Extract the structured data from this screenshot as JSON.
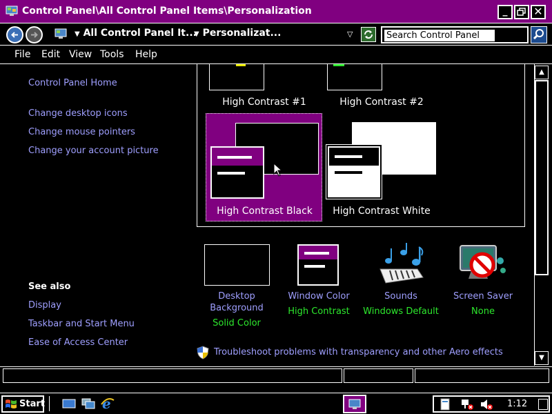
{
  "window": {
    "title": "Control Panel\\All Control Panel Items\\Personalization"
  },
  "address_bar": {
    "segment1": "All Control Panel It...",
    "segment2": "Personalizat...",
    "search_placeholder": "Search Control Panel"
  },
  "menu": {
    "items": [
      "File",
      "Edit",
      "View",
      "Tools",
      "Help"
    ]
  },
  "left_pane": {
    "home_link": "Control Panel Home",
    "links": [
      "Change desktop icons",
      "Change mouse pointers",
      "Change your account picture"
    ],
    "see_also_heading": "See also",
    "see_also_links": [
      "Display",
      "Taskbar and Start Menu",
      "Ease of Access Center"
    ]
  },
  "themes": {
    "items": [
      {
        "label": "High Contrast #1"
      },
      {
        "label": "High Contrast #2"
      },
      {
        "label": "High Contrast Black",
        "selected": true
      },
      {
        "label": "High Contrast White"
      }
    ]
  },
  "bottom_settings": {
    "desktop_background": {
      "title_line1": "Desktop",
      "title_line2": "Background",
      "value": "Solid Color"
    },
    "window_color": {
      "title": "Window Color",
      "value": "High Contrast"
    },
    "sounds": {
      "title": "Sounds",
      "value": "Windows Default"
    },
    "screen_saver": {
      "title": "Screen Saver",
      "value": "None"
    }
  },
  "troubleshoot_link": "Troubleshoot problems with transparency and other Aero effects",
  "taskbar": {
    "start_label": "Start",
    "clock": "1:12"
  },
  "colors": {
    "accent": "#800080",
    "link": "#9f9fff",
    "value": "#2de82d",
    "background": "#000000",
    "foreground": "#ffffff"
  },
  "icons": [
    "control-panel-icon",
    "back-arrow-icon",
    "forward-arrow-icon",
    "refresh-icon",
    "search-icon",
    "shield-icon",
    "windows-logo-icon",
    "volume-muted-icon",
    "network-icon"
  ]
}
